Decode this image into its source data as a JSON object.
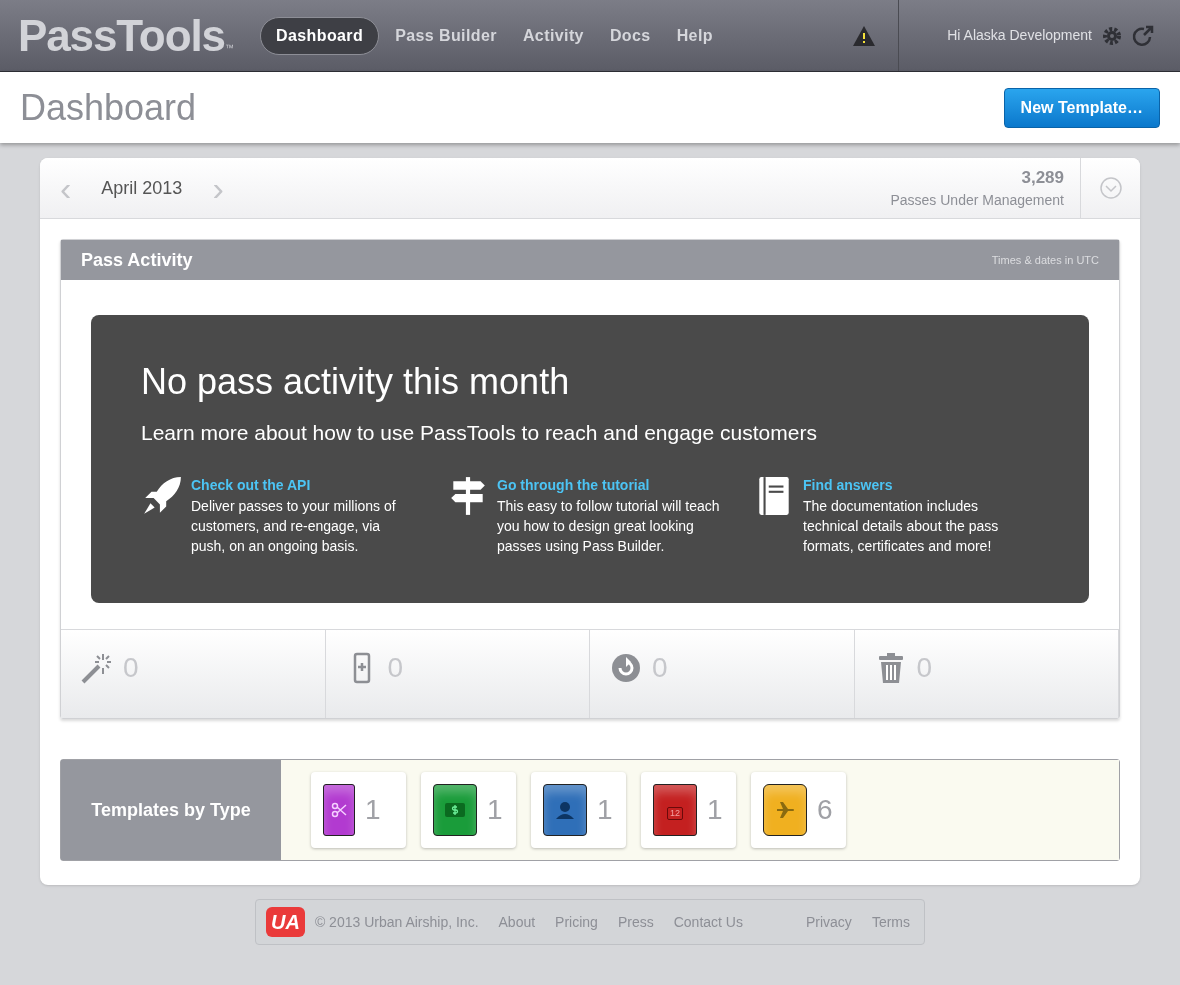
{
  "header": {
    "logo": "PassTools",
    "logo_mark": "™",
    "nav": [
      {
        "label": "Dashboard",
        "selected": true
      },
      {
        "label": "Pass Builder",
        "selected": false
      },
      {
        "label": "Activity",
        "selected": false
      },
      {
        "label": "Docs",
        "selected": false
      },
      {
        "label": "Help",
        "selected": false
      }
    ],
    "greeting": "Hi Alaska Development"
  },
  "page": {
    "title": "Dashboard",
    "new_button": "New Template…"
  },
  "period": {
    "prev": "‹",
    "month": "April 2013",
    "next": "›",
    "count": "3,289",
    "count_label": "Passes Under Management"
  },
  "activity": {
    "title": "Pass Activity",
    "note": "Times & dates in UTC",
    "empty": {
      "heading": "No pass activity this month",
      "subheading": "Learn more about how to use PassTools to reach and engage customers",
      "links": [
        {
          "kind": "rocket",
          "title": "Check out the API",
          "text": "Deliver passes to your millions of customers, and re-engage, via push, on an ongoing basis."
        },
        {
          "kind": "signpost",
          "title": "Go through the tutorial",
          "text": "This easy to follow tutorial will teach you how to design great looking passes using Pass Builder."
        },
        {
          "kind": "book",
          "title": "Find answers",
          "text": "The documentation includes technical details about the pass formats, certificates and more!"
        }
      ]
    },
    "stats": [
      {
        "kind": "wand",
        "value": "0"
      },
      {
        "kind": "phone",
        "value": "0"
      },
      {
        "kind": "refresh",
        "value": "0"
      },
      {
        "kind": "trash",
        "value": "0"
      }
    ]
  },
  "templates": {
    "title": "Templates by Type",
    "items": [
      {
        "kind": "coupon",
        "color": "#b23ad0",
        "count": "1"
      },
      {
        "kind": "store",
        "color": "#1a9c3a",
        "count": "1"
      },
      {
        "kind": "generic",
        "color": "#2f6fb8",
        "count": "1"
      },
      {
        "kind": "event",
        "color": "#c42020",
        "count": "1",
        "icon_text": "12"
      },
      {
        "kind": "boarding",
        "color": "#f0b020",
        "count": "6"
      }
    ]
  },
  "footer": {
    "logo": "UA",
    "copyright": "© 2013 Urban Airship, Inc.",
    "links": [
      "About",
      "Pricing",
      "Press",
      "Contact Us"
    ],
    "legal": [
      "Privacy",
      "Terms"
    ]
  }
}
